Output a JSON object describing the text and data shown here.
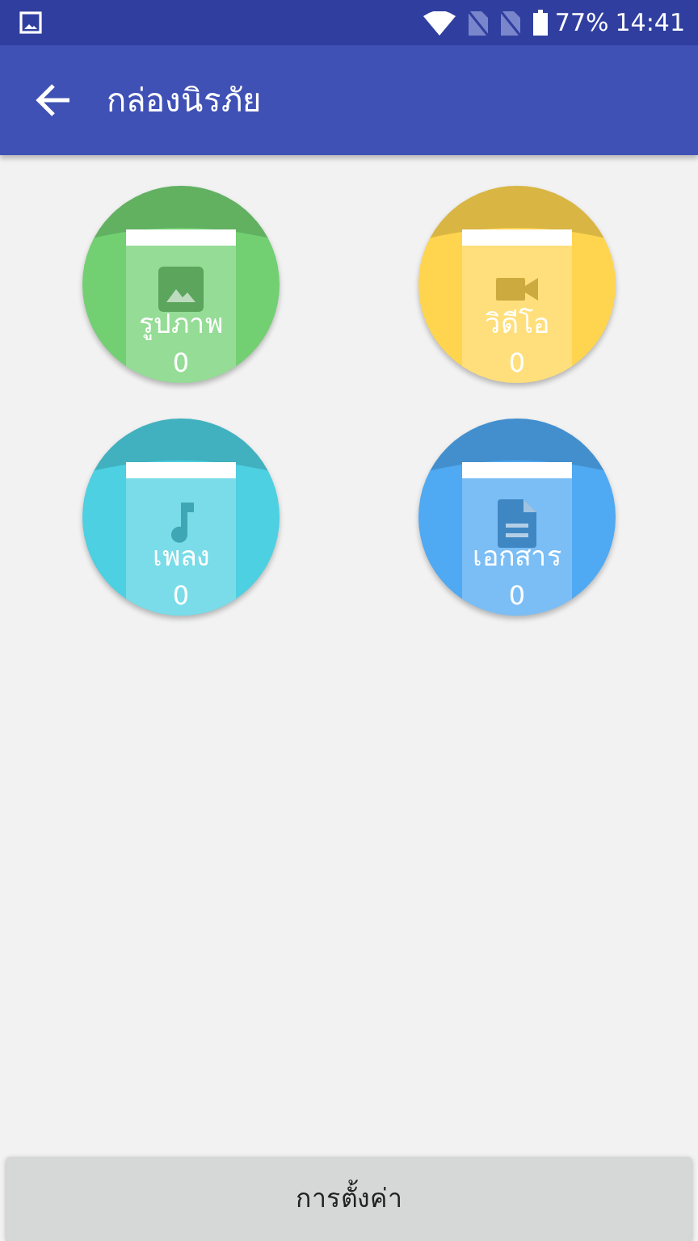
{
  "status_bar": {
    "battery": "77%",
    "time": "14:41"
  },
  "app_bar": {
    "title": "กล่องนิรภัย"
  },
  "categories": [
    {
      "kind": "image",
      "label": "รูปภาพ",
      "count": "0",
      "color": "#72d073"
    },
    {
      "kind": "video",
      "label": "วิดีโอ",
      "count": "0",
      "color": "#ffd54f"
    },
    {
      "kind": "music",
      "label": "เพลง",
      "count": "0",
      "color": "#4dd0e1"
    },
    {
      "kind": "document",
      "label": "เอกสาร",
      "count": "0",
      "color": "#4fa9f3"
    }
  ],
  "footer": {
    "button": "การตั้งค่า"
  }
}
